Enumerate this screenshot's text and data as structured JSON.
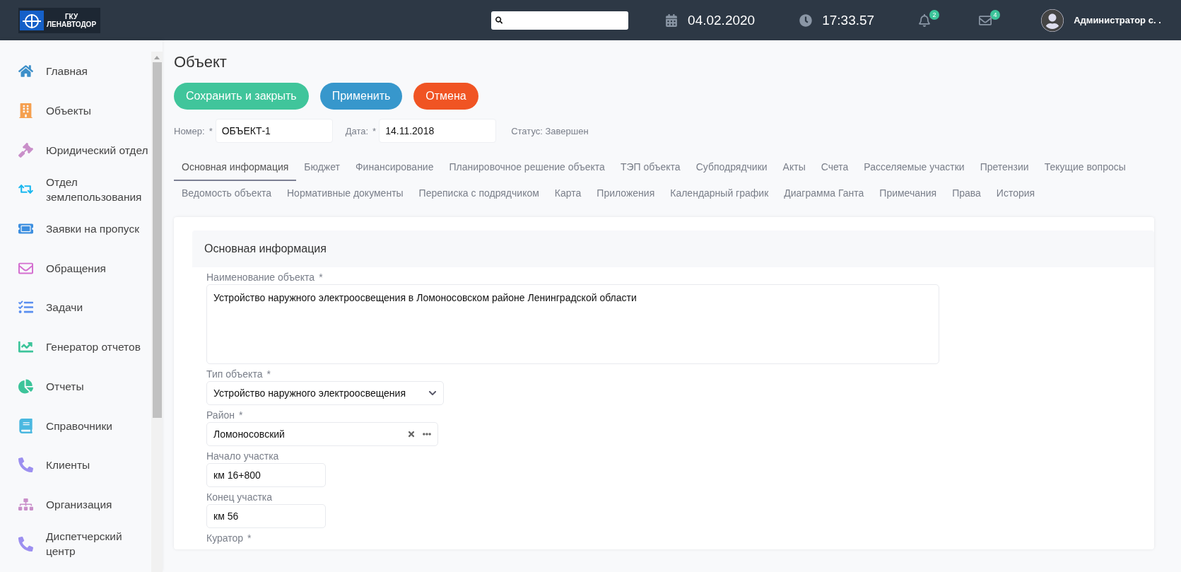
{
  "header": {
    "logo": {
      "line1": "ГКУ",
      "line2": "ЛЕНАВТОДОР"
    },
    "date": "04.02.2020",
    "time": "17:33.57",
    "notifications": {
      "count": "2"
    },
    "messages": {
      "count": "4"
    },
    "user": {
      "name": "Администратор с. ."
    }
  },
  "sidebar": {
    "items": [
      {
        "label": "Главная",
        "kind": "home",
        "color": "#3d8fc9"
      },
      {
        "label": "Объекты",
        "kind": "building",
        "color": "#f5a050"
      },
      {
        "label": "Юридический отдел",
        "kind": "gavel",
        "color": "#c98fc9"
      },
      {
        "label": "Отдел землепользования",
        "kind": "exchange",
        "color": "#1ab8f0"
      },
      {
        "label": "Заявки на пропуск",
        "kind": "ticket",
        "color": "#3d8fe0"
      },
      {
        "label": "Обращения",
        "kind": "envelope",
        "color": "#d46fd0"
      },
      {
        "label": "Задачи",
        "kind": "tasks",
        "color": "#5a8ff0"
      },
      {
        "label": "Генератор отчетов",
        "kind": "chart",
        "color": "#3cc49a"
      },
      {
        "label": "Отчеты",
        "kind": "pie",
        "color": "#3cc49a"
      },
      {
        "label": "Справочники",
        "kind": "book",
        "color": "#4ab8e0"
      },
      {
        "label": "Клиенты",
        "kind": "phone",
        "color": "#9c8ff0"
      },
      {
        "label": "Организация",
        "kind": "sitemap",
        "color": "#c98fc9"
      },
      {
        "label": "Диспетчерский центр",
        "kind": "phone",
        "color": "#9c8ff0"
      }
    ]
  },
  "page": {
    "title": "Объект",
    "buttons": [
      {
        "label": "Сохранить и закрыть",
        "kind": "save"
      },
      {
        "label": "Применить",
        "kind": "apply"
      },
      {
        "label": "Отмена",
        "kind": "cancel"
      }
    ],
    "meta": {
      "number": {
        "label": "Номер:",
        "mark": "*",
        "value": "ОБЪЕКТ-1"
      },
      "date": {
        "label": "Дата:",
        "mark": "*",
        "value": "14.11.2018"
      },
      "status": "Статус: Завершен"
    },
    "tab_rows": [
      [
        {
          "label": "Основная информация",
          "selected": true
        },
        {
          "label": "Бюджет",
          "selected": false
        },
        {
          "label": "Финансирование",
          "selected": false
        },
        {
          "label": "Планировочное решение объекта",
          "selected": false
        },
        {
          "label": "ТЭП объекта",
          "selected": false
        },
        {
          "label": "Субподрядчики",
          "selected": false
        },
        {
          "label": "Акты",
          "selected": false
        },
        {
          "label": "Счета",
          "selected": false
        },
        {
          "label": "Расселяемые участки",
          "selected": false
        },
        {
          "label": "Претензии",
          "selected": false
        },
        {
          "label": "Текущие вопросы",
          "selected": false
        }
      ],
      [
        {
          "label": "Ведомость объекта",
          "selected": false
        },
        {
          "label": "Нормативные документы",
          "selected": false
        },
        {
          "label": "Переписка с подрядчиком",
          "selected": false
        },
        {
          "label": "Карта",
          "selected": false
        },
        {
          "label": "Приложения",
          "selected": false
        },
        {
          "label": "Календарный график",
          "selected": false
        },
        {
          "label": "Диаграмма Ганта",
          "selected": false
        },
        {
          "label": "Примечания",
          "selected": false
        },
        {
          "label": "Права",
          "selected": false
        },
        {
          "label": "История",
          "selected": false
        }
      ]
    ],
    "section": {
      "title": "Основная информация",
      "fields": [
        {
          "kind": "textarea",
          "label": "Наименование объекта",
          "mark": "*",
          "value": "Устройство наружного электроосвещения в Ломоносовском районе Ленинградской области"
        },
        {
          "kind": "select",
          "label": "Тип объекта",
          "mark": "*",
          "value": "Устройство наружного электроосвещения"
        },
        {
          "kind": "lookup",
          "label": "Район",
          "mark": "*",
          "value": "Ломоносовский"
        },
        {
          "kind": "short",
          "label": "Начало участка",
          "value": "км 16+800"
        },
        {
          "kind": "short",
          "label": "Конец участка",
          "value": "км 56"
        },
        {
          "kind": "label_only",
          "label": "Куратор",
          "mark": "*"
        }
      ]
    }
  }
}
